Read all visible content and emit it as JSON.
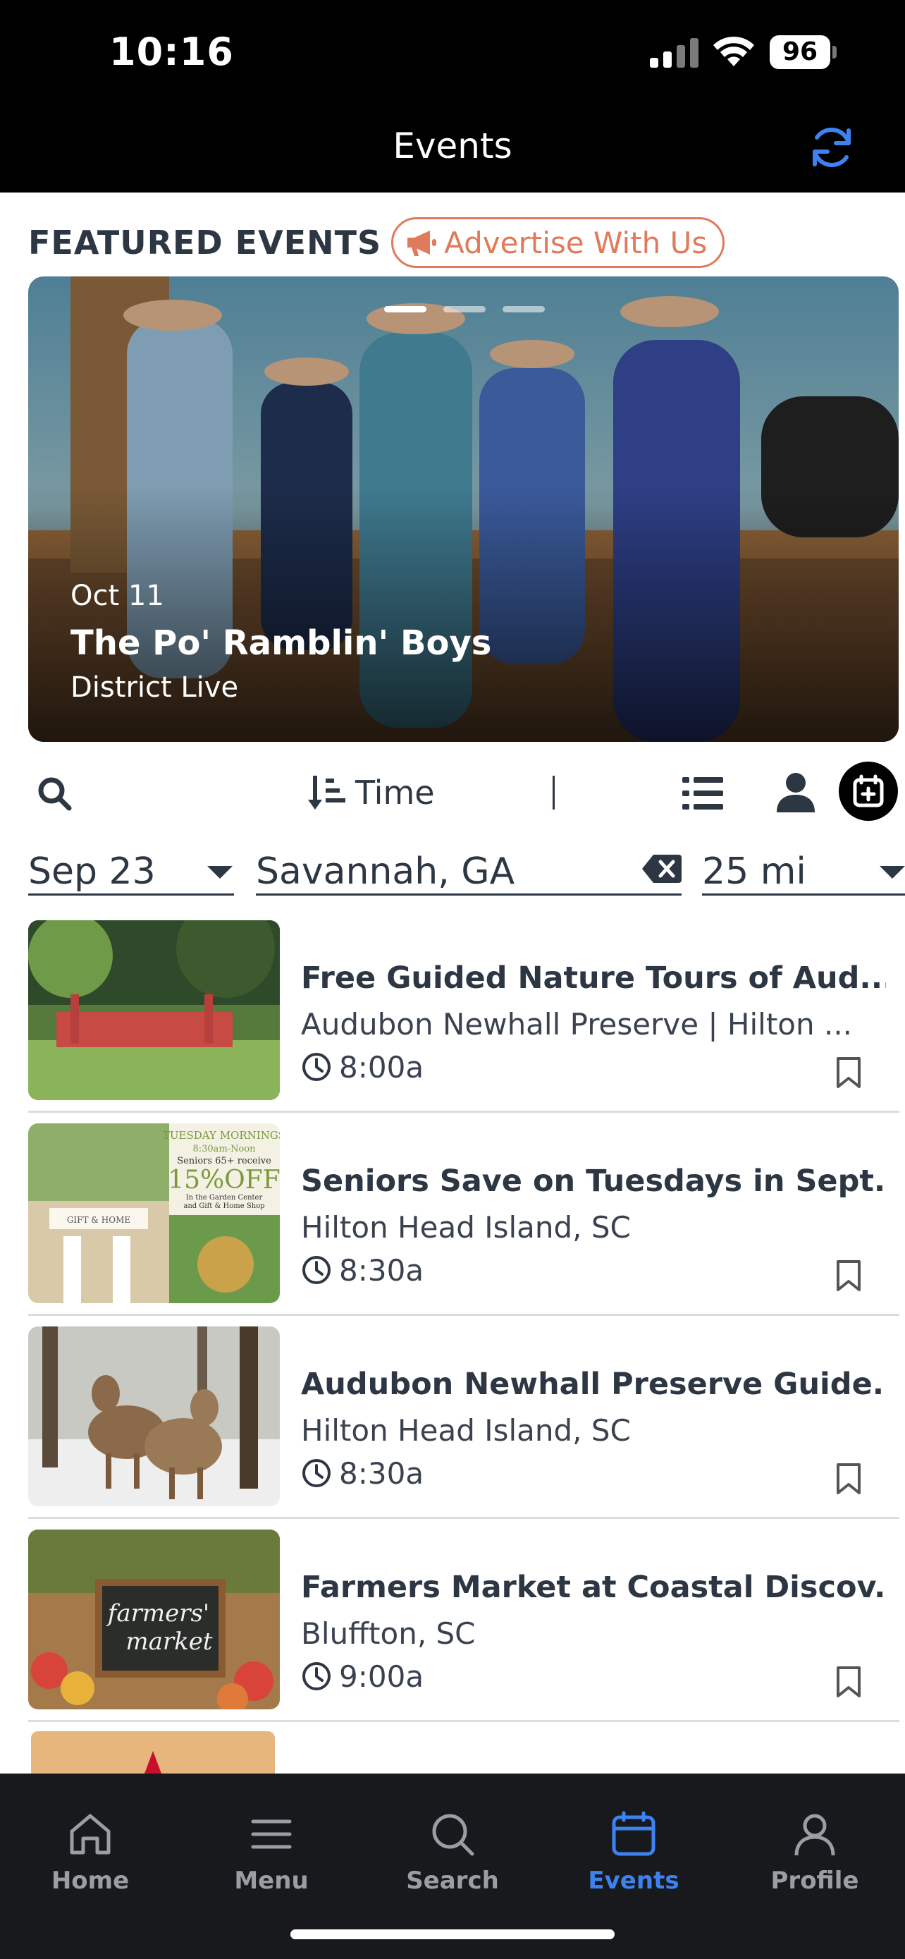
{
  "status_bar": {
    "time": "10:16",
    "battery": "96"
  },
  "header": {
    "title": "Events",
    "refresh_icon": "refresh-icon"
  },
  "featured": {
    "title": "FEATURED EVENTS",
    "advertise_label": "Advertise With Us",
    "banner": {
      "date": "Oct 11",
      "name": "The Po' Ramblin' Boys",
      "venue": "District Live",
      "slide_count": 3,
      "active_slide": 1
    }
  },
  "toolbar": {
    "sort_label": "Time"
  },
  "filters": {
    "date": "Sep 23",
    "location": "Savannah, GA",
    "distance": "25 mi"
  },
  "events": [
    {
      "title": "Free Guided Nature Tours of Aud...",
      "location": "Audubon Newhall Preserve | Hilton ...",
      "time": "8:00a"
    },
    {
      "title": "Seniors Save on Tuesdays in Sept...",
      "location": "Hilton Head Island, SC",
      "time": "8:30a"
    },
    {
      "title": "Audubon Newhall Preserve Guide...",
      "location": "Hilton Head Island, SC",
      "time": "8:30a"
    },
    {
      "title": "Farmers Market at Coastal Discov...",
      "location": "Bluffton, SC",
      "time": "9:00a"
    }
  ],
  "thumb_text": {
    "seniors_top": "TUESDAY MORNINGS",
    "seniors_time": "8:30am-Noon",
    "seniors_sub": "Seniors 65+ receive",
    "seniors_discount": "15%OFF",
    "seniors_fine": "In the Garden Center",
    "seniors_fine2": "and Gift & Home Shop",
    "seniors_sign": "GIFT & HOME",
    "market_1": "farmers'",
    "market_2": "market"
  },
  "tabs": [
    {
      "label": "Home",
      "icon": "home-icon"
    },
    {
      "label": "Menu",
      "icon": "menu-icon"
    },
    {
      "label": "Search",
      "icon": "search-icon"
    },
    {
      "label": "Events",
      "icon": "calendar-icon",
      "active": true
    },
    {
      "label": "Profile",
      "icon": "person-icon"
    }
  ],
  "colors": {
    "accent": "#3d82f0",
    "advertise": "#e07a5a",
    "header_bg": "#000000",
    "tab_bar_bg": "#17191c",
    "text": "#2d3643"
  }
}
